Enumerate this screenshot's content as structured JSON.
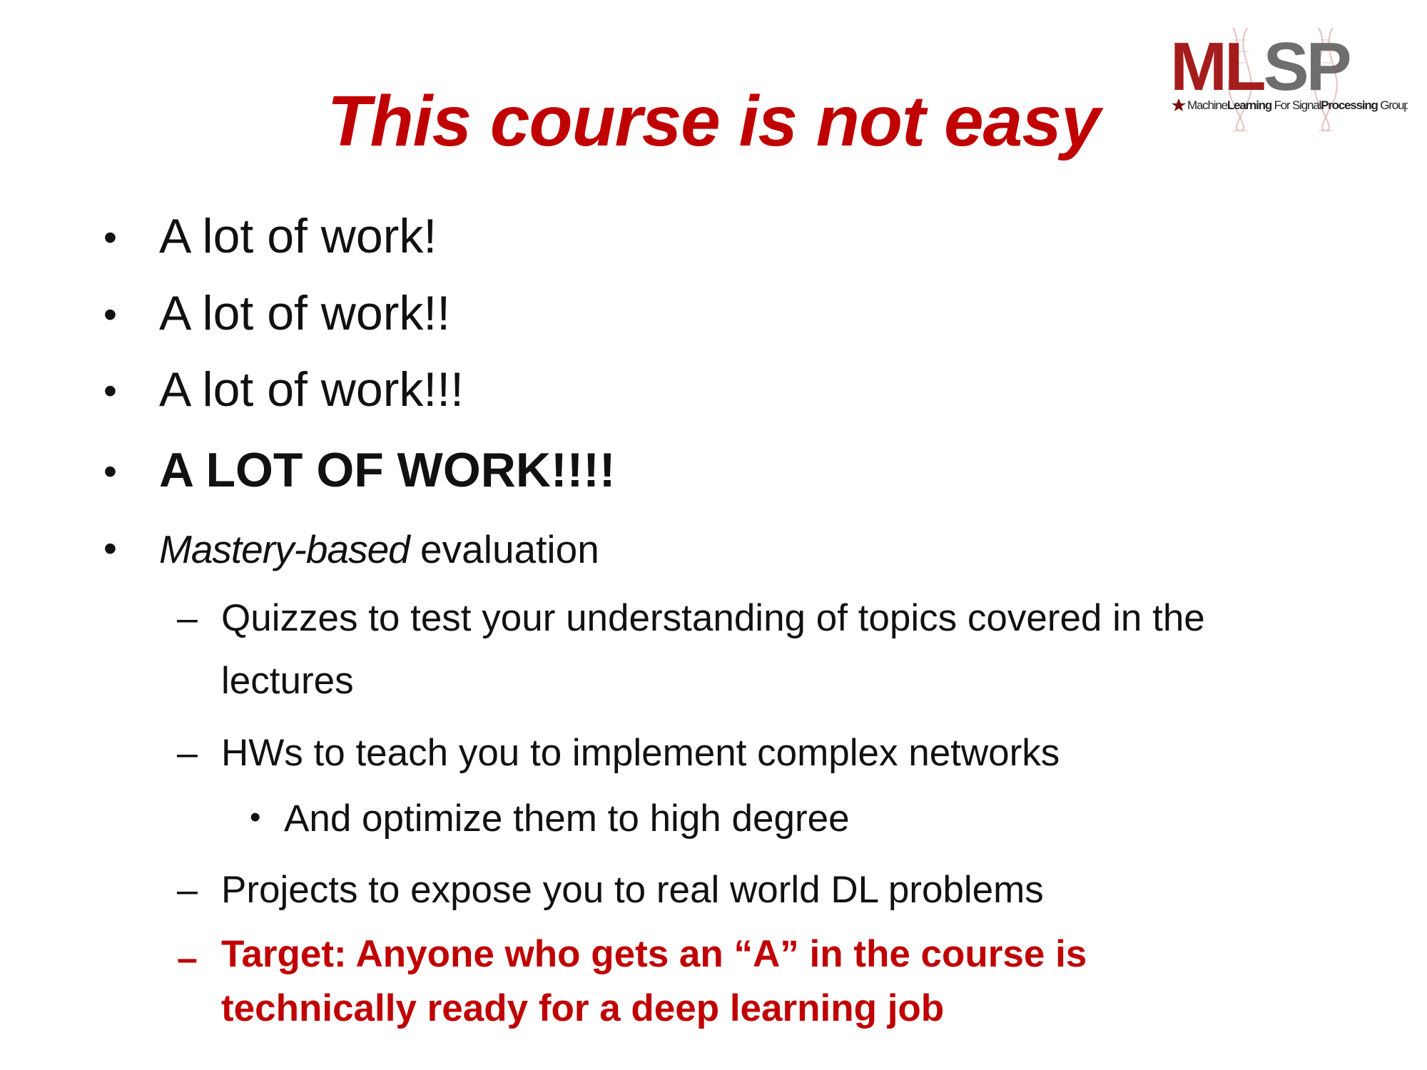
{
  "slide": {
    "title": "This course is not easy",
    "logo": {
      "wordmark": "MLSP",
      "tagline_part1": "Machine",
      "tagline_part2": "Learning",
      "tagline_part3": " For Signal",
      "tagline_part4": "Processing",
      "tagline_part5": " Group"
    },
    "bullets": [
      "A lot of work!",
      "A lot of work!!",
      "A lot of work!!!",
      "A LOT OF WORK!!!!"
    ],
    "mastery": {
      "emphasis": "Mastery-based",
      "rest": " evaluation"
    },
    "sub_items": {
      "quizzes": "Quizzes to test your understanding of topics covered in the lectures",
      "hws": "HWs to teach you to implement complex networks",
      "hws_sub": "And optimize them to high degree",
      "projects": "Projects to expose you to real world DL problems",
      "target": "Target: Anyone who gets an “A” in the course is technically ready for a deep learning job"
    },
    "markers": {
      "bullet": "•",
      "dash": "–"
    },
    "colors": {
      "accent": "#c00000",
      "text": "#111111"
    }
  }
}
